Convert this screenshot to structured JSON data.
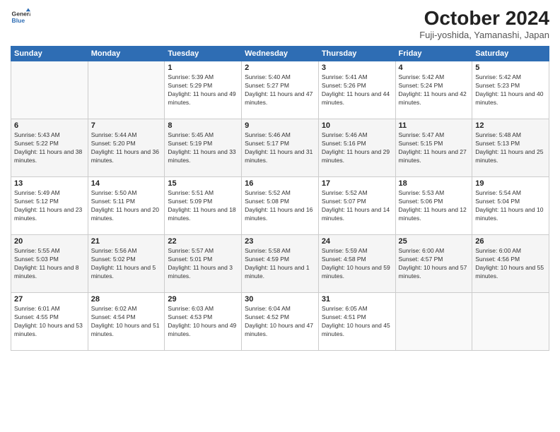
{
  "header": {
    "logo_line1": "General",
    "logo_line2": "Blue",
    "month": "October 2024",
    "location": "Fuji-yoshida, Yamanashi, Japan"
  },
  "days_of_week": [
    "Sunday",
    "Monday",
    "Tuesday",
    "Wednesday",
    "Thursday",
    "Friday",
    "Saturday"
  ],
  "weeks": [
    [
      {
        "day": "",
        "info": ""
      },
      {
        "day": "",
        "info": ""
      },
      {
        "day": "1",
        "info": "Sunrise: 5:39 AM\nSunset: 5:29 PM\nDaylight: 11 hours and 49 minutes."
      },
      {
        "day": "2",
        "info": "Sunrise: 5:40 AM\nSunset: 5:27 PM\nDaylight: 11 hours and 47 minutes."
      },
      {
        "day": "3",
        "info": "Sunrise: 5:41 AM\nSunset: 5:26 PM\nDaylight: 11 hours and 44 minutes."
      },
      {
        "day": "4",
        "info": "Sunrise: 5:42 AM\nSunset: 5:24 PM\nDaylight: 11 hours and 42 minutes."
      },
      {
        "day": "5",
        "info": "Sunrise: 5:42 AM\nSunset: 5:23 PM\nDaylight: 11 hours and 40 minutes."
      }
    ],
    [
      {
        "day": "6",
        "info": "Sunrise: 5:43 AM\nSunset: 5:22 PM\nDaylight: 11 hours and 38 minutes."
      },
      {
        "day": "7",
        "info": "Sunrise: 5:44 AM\nSunset: 5:20 PM\nDaylight: 11 hours and 36 minutes."
      },
      {
        "day": "8",
        "info": "Sunrise: 5:45 AM\nSunset: 5:19 PM\nDaylight: 11 hours and 33 minutes."
      },
      {
        "day": "9",
        "info": "Sunrise: 5:46 AM\nSunset: 5:17 PM\nDaylight: 11 hours and 31 minutes."
      },
      {
        "day": "10",
        "info": "Sunrise: 5:46 AM\nSunset: 5:16 PM\nDaylight: 11 hours and 29 minutes."
      },
      {
        "day": "11",
        "info": "Sunrise: 5:47 AM\nSunset: 5:15 PM\nDaylight: 11 hours and 27 minutes."
      },
      {
        "day": "12",
        "info": "Sunrise: 5:48 AM\nSunset: 5:13 PM\nDaylight: 11 hours and 25 minutes."
      }
    ],
    [
      {
        "day": "13",
        "info": "Sunrise: 5:49 AM\nSunset: 5:12 PM\nDaylight: 11 hours and 23 minutes."
      },
      {
        "day": "14",
        "info": "Sunrise: 5:50 AM\nSunset: 5:11 PM\nDaylight: 11 hours and 20 minutes."
      },
      {
        "day": "15",
        "info": "Sunrise: 5:51 AM\nSunset: 5:09 PM\nDaylight: 11 hours and 18 minutes."
      },
      {
        "day": "16",
        "info": "Sunrise: 5:52 AM\nSunset: 5:08 PM\nDaylight: 11 hours and 16 minutes."
      },
      {
        "day": "17",
        "info": "Sunrise: 5:52 AM\nSunset: 5:07 PM\nDaylight: 11 hours and 14 minutes."
      },
      {
        "day": "18",
        "info": "Sunrise: 5:53 AM\nSunset: 5:06 PM\nDaylight: 11 hours and 12 minutes."
      },
      {
        "day": "19",
        "info": "Sunrise: 5:54 AM\nSunset: 5:04 PM\nDaylight: 11 hours and 10 minutes."
      }
    ],
    [
      {
        "day": "20",
        "info": "Sunrise: 5:55 AM\nSunset: 5:03 PM\nDaylight: 11 hours and 8 minutes."
      },
      {
        "day": "21",
        "info": "Sunrise: 5:56 AM\nSunset: 5:02 PM\nDaylight: 11 hours and 5 minutes."
      },
      {
        "day": "22",
        "info": "Sunrise: 5:57 AM\nSunset: 5:01 PM\nDaylight: 11 hours and 3 minutes."
      },
      {
        "day": "23",
        "info": "Sunrise: 5:58 AM\nSunset: 4:59 PM\nDaylight: 11 hours and 1 minute."
      },
      {
        "day": "24",
        "info": "Sunrise: 5:59 AM\nSunset: 4:58 PM\nDaylight: 10 hours and 59 minutes."
      },
      {
        "day": "25",
        "info": "Sunrise: 6:00 AM\nSunset: 4:57 PM\nDaylight: 10 hours and 57 minutes."
      },
      {
        "day": "26",
        "info": "Sunrise: 6:00 AM\nSunset: 4:56 PM\nDaylight: 10 hours and 55 minutes."
      }
    ],
    [
      {
        "day": "27",
        "info": "Sunrise: 6:01 AM\nSunset: 4:55 PM\nDaylight: 10 hours and 53 minutes."
      },
      {
        "day": "28",
        "info": "Sunrise: 6:02 AM\nSunset: 4:54 PM\nDaylight: 10 hours and 51 minutes."
      },
      {
        "day": "29",
        "info": "Sunrise: 6:03 AM\nSunset: 4:53 PM\nDaylight: 10 hours and 49 minutes."
      },
      {
        "day": "30",
        "info": "Sunrise: 6:04 AM\nSunset: 4:52 PM\nDaylight: 10 hours and 47 minutes."
      },
      {
        "day": "31",
        "info": "Sunrise: 6:05 AM\nSunset: 4:51 PM\nDaylight: 10 hours and 45 minutes."
      },
      {
        "day": "",
        "info": ""
      },
      {
        "day": "",
        "info": ""
      }
    ]
  ]
}
